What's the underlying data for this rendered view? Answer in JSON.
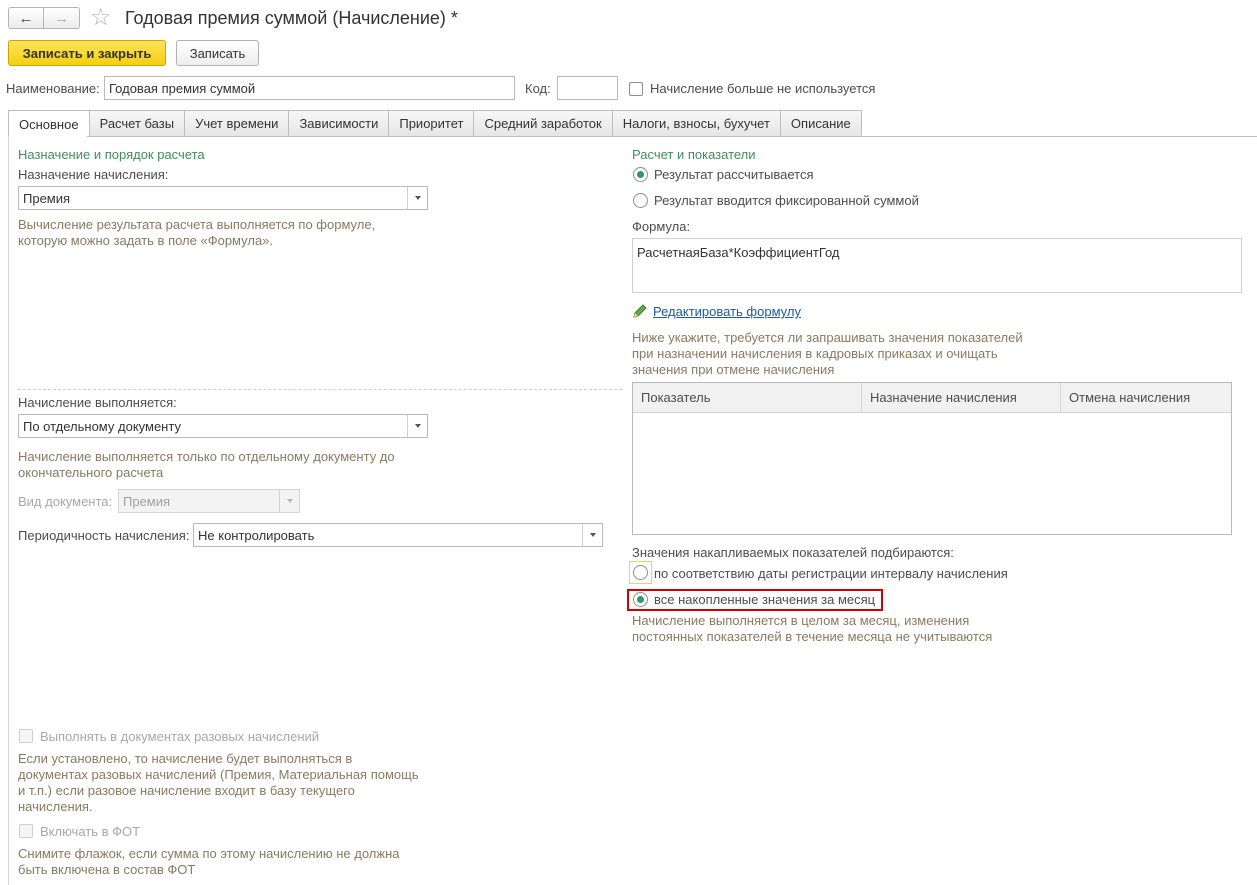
{
  "window": {
    "title": "Годовая премия суммой (Начисление) *",
    "back_icon": "←",
    "forward_icon": "→",
    "star_icon": "☆"
  },
  "toolbar": {
    "save_close_label": "Записать и закрыть",
    "save_label": "Записать"
  },
  "header": {
    "name_label": "Наименование:",
    "name_value": "Годовая премия суммой",
    "code_label": "Код:",
    "code_value": "",
    "unused_label": "Начисление больше не используется"
  },
  "tabs": [
    {
      "label": "Основное"
    },
    {
      "label": "Расчет базы"
    },
    {
      "label": "Учет времени"
    },
    {
      "label": "Зависимости"
    },
    {
      "label": "Приоритет"
    },
    {
      "label": "Средний заработок"
    },
    {
      "label": "Налоги, взносы, бухучет"
    },
    {
      "label": "Описание"
    }
  ],
  "left": {
    "section_title": "Назначение и порядок расчета",
    "purpose_label": "Назначение начисления:",
    "purpose_value": "Премия",
    "purpose_hint": "Вычисление результата расчета выполняется по формуле, которую можно задать в поле «Формула».",
    "exec_label": "Начисление выполняется:",
    "exec_value": "По отдельному документу",
    "exec_hint": "Начисление выполняется только по отдельному документу до окончательного расчета",
    "doc_type_label": "Вид документа:",
    "doc_type_value": "Премия",
    "period_label": "Периодичность начисления:",
    "period_value": "Не контролировать",
    "one_time_label": "Выполнять в документах разовых начислений",
    "one_time_hint": "Если установлено, то начисление будет выполняться в документах разовых начислений (Премия, Материальная помощь и т.п.) если разовое начисление входит в базу текущего начисления.",
    "fot_label": "Включать в ФОТ",
    "fot_hint": "Снимите флажок, если сумма по этому начислению не должна быть включена в состав ФОТ"
  },
  "right": {
    "section_title": "Расчет и показатели",
    "radio_calc": "Результат рассчитывается",
    "radio_fixed": "Результат вводится фиксированной суммой",
    "formula_label": "Формула:",
    "formula_value": "РасчетнаяБаза*КоэффициентГод",
    "edit_formula_link": "Редактировать формулу",
    "indicators_hint": "Ниже укажите, требуется ли запрашивать значения показателей при назначении начисления в кадровых приказах и очищать значения при отмене начисления",
    "table_headers": [
      "Показатель",
      "Назначение начисления",
      "Отмена начисления"
    ],
    "accum_label": "Значения накапливаемых показателей подбираются:",
    "accum_option1": "по соответствию даты регистрации интервалу начисления",
    "accum_option2": "все накопленные значения за месяц",
    "accum_hint": "Начисление выполняется в целом за месяц, изменения постоянных показателей в течение месяца не учитываются"
  },
  "colors": {
    "accent_green": "#3d8f5a",
    "hint": "#8a7a5f",
    "primary_button": "#f5cf10",
    "highlight": "#d40000",
    "link": "#1d59a6"
  }
}
